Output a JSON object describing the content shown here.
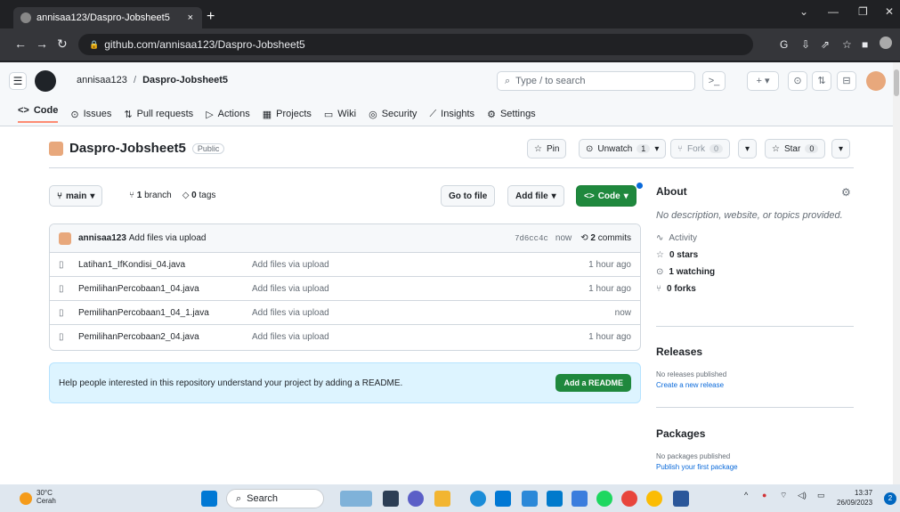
{
  "browser": {
    "tab_title": "annisaa123/Daspro-Jobsheet5",
    "tab_close": "×",
    "new_tab": "+",
    "url": "github.com/annisaa123/Daspro-Jobsheet5"
  },
  "header": {
    "owner": "annisaa123",
    "separator": "/",
    "repo": "Daspro-Jobsheet5",
    "search_placeholder": "Type / to search"
  },
  "repo_nav": [
    {
      "label": "Code",
      "icon": "<>"
    },
    {
      "label": "Issues",
      "icon": "⊙"
    },
    {
      "label": "Pull requests",
      "icon": "⇅"
    },
    {
      "label": "Actions",
      "icon": "▷"
    },
    {
      "label": "Projects",
      "icon": "▦"
    },
    {
      "label": "Wiki",
      "icon": "▭"
    },
    {
      "label": "Security",
      "icon": "◎"
    },
    {
      "label": "Insights",
      "icon": "⟋"
    },
    {
      "label": "Settings",
      "icon": "⚙"
    }
  ],
  "repo_header": {
    "name": "Daspro-Jobsheet5",
    "visibility": "Public",
    "pin": "Pin",
    "unwatch": "Unwatch",
    "watch_count": "1",
    "fork": "Fork",
    "fork_count": "0",
    "star": "Star",
    "star_count": "0"
  },
  "branch": {
    "name": "main",
    "branches": "1",
    "branches_label": "branch",
    "tags": "0",
    "tags_label": "tags",
    "go_to_file": "Go to file",
    "add_file": "Add file",
    "code": "Code"
  },
  "commit": {
    "author": "annisaa123",
    "message": "Add files via upload",
    "hash": "7d6cc4c",
    "time": "now",
    "commits": "2",
    "commits_label": "commits"
  },
  "files": [
    {
      "name": "Latihan1_IfKondisi_04.java",
      "message": "Add files via upload",
      "time": "1 hour ago"
    },
    {
      "name": "PemilihanPercobaan1_04.java",
      "message": "Add files via upload",
      "time": "1 hour ago"
    },
    {
      "name": "PemilihanPercobaan1_04_1.java",
      "message": "Add files via upload",
      "time": "now"
    },
    {
      "name": "PemilihanPercobaan2_04.java",
      "message": "Add files via upload",
      "time": "1 hour ago"
    }
  ],
  "readme": {
    "text": "Help people interested in this repository understand your project by adding a README.",
    "button": "Add a README"
  },
  "about": {
    "title": "About",
    "description": "No description, website, or topics provided.",
    "activity": "Activity",
    "stars": "0 stars",
    "watching": "1 watching",
    "forks": "0 forks"
  },
  "releases": {
    "title": "Releases",
    "none": "No releases published",
    "link": "Create a new release"
  },
  "packages": {
    "title": "Packages",
    "none": "No packages published",
    "link": "Publish your first package"
  },
  "taskbar": {
    "temp": "30°C",
    "weather": "Cerah",
    "search": "Search",
    "time": "13:37",
    "date": "26/09/2023",
    "notifications": "2"
  }
}
